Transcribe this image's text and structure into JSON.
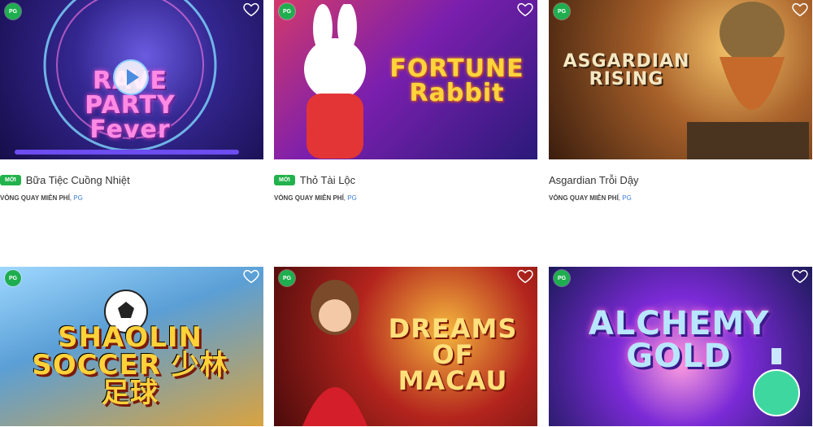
{
  "common": {
    "provider_badge": "PG",
    "new_badge": "MỚI",
    "meta_label": "VÒNG QUAY MIỄN PHÍ",
    "meta_separator": ", ",
    "provider_name": "PG"
  },
  "games": [
    {
      "name": "Bữa Tiệc Cuồng Nhiệt",
      "is_new": true,
      "artwork_text": "RAVE PARTY Fever"
    },
    {
      "name": "Thỏ Tài Lộc",
      "is_new": true,
      "artwork_text": "FORTUNE Rabbit"
    },
    {
      "name": "Asgardian Trỗi Dậy",
      "is_new": false,
      "artwork_text": "ASGARDIAN RISING"
    },
    {
      "name": "",
      "is_new": false,
      "artwork_text": "SHAOLIN SOCCER 少林足球"
    },
    {
      "name": "",
      "is_new": false,
      "artwork_text": "DREAMS OF MACAU"
    },
    {
      "name": "",
      "is_new": false,
      "artwork_text": "ALCHEMY GOLD"
    }
  ],
  "colors": {
    "provider_badge": "#1fae4f",
    "new_badge": "#22b24c",
    "provider_link": "#3b7ed6"
  },
  "icons": {
    "favorite": "heart-outline-icon",
    "play": "play-icon"
  }
}
